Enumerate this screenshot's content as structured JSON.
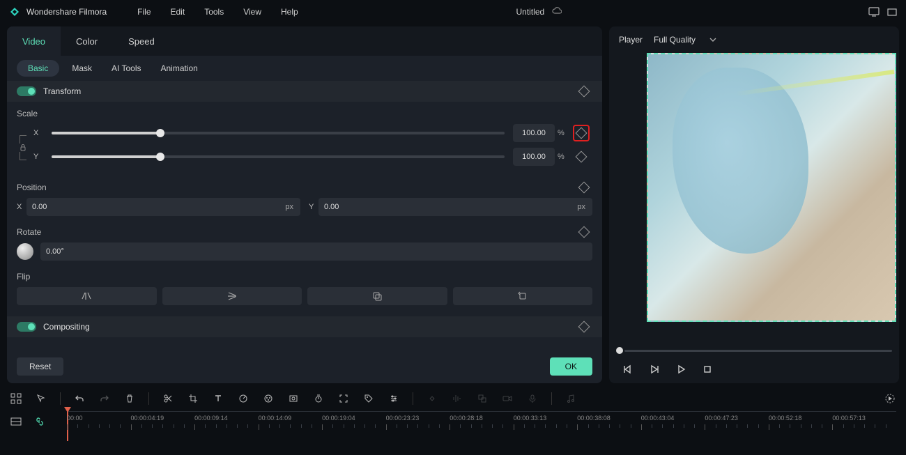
{
  "app_name": "Wondershare Filmora",
  "menu": [
    "File",
    "Edit",
    "Tools",
    "View",
    "Help"
  ],
  "doc_title": "Untitled",
  "main_tabs": [
    "Video",
    "Color",
    "Speed"
  ],
  "sub_tabs": [
    "Basic",
    "Mask",
    "AI Tools",
    "Animation"
  ],
  "transform": {
    "label": "Transform",
    "scale": {
      "label": "Scale",
      "x_label": "X",
      "y_label": "Y",
      "x_value": "100.00",
      "y_value": "100.00",
      "unit": "%",
      "x_percent": 24,
      "y_percent": 24
    },
    "position": {
      "label": "Position",
      "x_label": "X",
      "y_label": "Y",
      "x_value": "0.00",
      "y_value": "0.00",
      "unit": "px"
    },
    "rotate": {
      "label": "Rotate",
      "value": "0.00°"
    },
    "flip": {
      "label": "Flip"
    }
  },
  "compositing": {
    "label": "Compositing"
  },
  "footer": {
    "reset": "Reset",
    "ok": "OK"
  },
  "player": {
    "title": "Player",
    "quality": "Full Quality"
  },
  "timeline_ticks": [
    "00:00",
    "00:00:04:19",
    "00:00:09:14",
    "00:00:14:09",
    "00:00:19:04",
    "00:00:23:23",
    "00:00:28:18",
    "00:00:33:13",
    "00:00:38:08",
    "00:00:43:04",
    "00:00:47:23",
    "00:00:52:18",
    "00:00:57:13"
  ]
}
